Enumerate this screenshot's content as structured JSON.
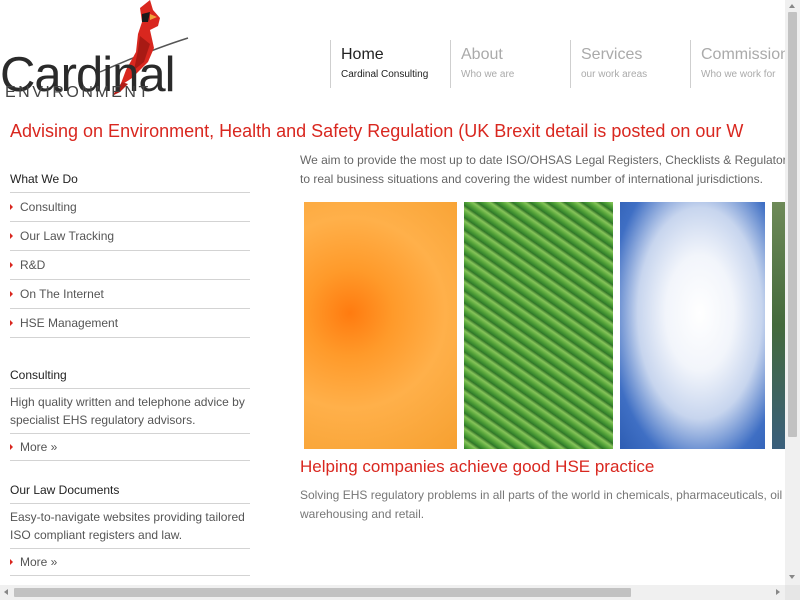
{
  "logo": {
    "word": "Cardinal",
    "sub": "ENVIRONMENT",
    "icon": "cardinal-bird-icon"
  },
  "nav": [
    {
      "title": "Home",
      "sub": "Cardinal Consulting",
      "active": true
    },
    {
      "title": "About",
      "sub": "Who we are",
      "active": false
    },
    {
      "title": "Services",
      "sub": "our work areas",
      "active": false
    },
    {
      "title": "Commission",
      "sub": "Who we work for",
      "active": false
    }
  ],
  "headline": "Advising on Environment, Health and Safety Regulation (UK Brexit detail is posted on our W",
  "sidebar": {
    "what_we_do": {
      "heading": "What We Do",
      "items": [
        "Consulting",
        "Our Law Tracking",
        "R&D",
        "On The Internet",
        "HSE Management"
      ]
    },
    "consulting": {
      "heading": "Consulting",
      "text": "High quality written and telephone advice by specialist EHS regulatory advisors.",
      "more": "More »"
    },
    "law_docs": {
      "heading": "Our Law Documents",
      "text": "Easy-to-navigate websites providing tailored ISO compliant registers and law.",
      "more": "More »"
    }
  },
  "main": {
    "intro_line1": "We aim to provide the most up to date ISO/OHSAS Legal Registers, Checklists & Regulator",
    "intro_line2": "to real business situations and covering the widest number of international jurisdictions.",
    "subhead": "Helping companies achieve good HSE practice",
    "para_line1": "Solving EHS regulatory problems in all parts of the world in chemicals, pharmaceuticals, oil",
    "para_line2": "warehousing and retail."
  },
  "colors": {
    "accent": "#d9271f",
    "text": "#555555",
    "divider": "#d3d3d3"
  }
}
